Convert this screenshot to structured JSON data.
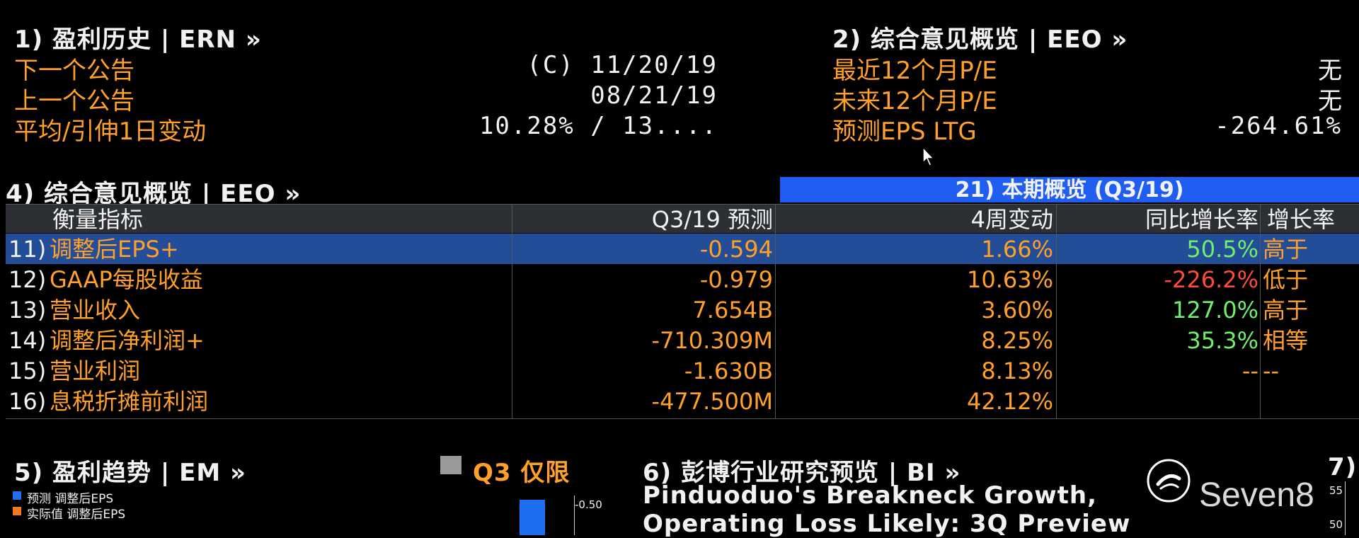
{
  "earnings_history": {
    "title": "1) 盈利历史  |  ERN »",
    "rows": [
      {
        "label": "下一个公告",
        "value": "(C)  11/20/19"
      },
      {
        "label": "上一个公告",
        "value": "08/21/19"
      },
      {
        "label": "平均/引伸1日变动",
        "value": "10.28% / 13...."
      }
    ]
  },
  "consensus_top": {
    "title": "2) 综合意见概览  |  EEO »",
    "rows": [
      {
        "label": "最近12个月P/E",
        "value": "无"
      },
      {
        "label": "未来12个月P/E",
        "value": "无"
      },
      {
        "label": "预测EPS LTG",
        "value": "-264.61%"
      }
    ]
  },
  "consensus_table": {
    "title": "4) 综合意见概览  |  EEO »",
    "banner": "21) 本期概览 (Q3/19)",
    "headers": [
      "衡量指标",
      "Q3/19 预测",
      "4周变动",
      "同比增长率",
      "增长率"
    ],
    "rows": [
      {
        "num": "11)",
        "metric": "调整后EPS+",
        "forecast": "-0.594",
        "change": "1.66%",
        "yoy": "50.5%",
        "yoy_color": "green",
        "growth": "高于"
      },
      {
        "num": "12)",
        "metric": "GAAP每股收益",
        "forecast": "-0.979",
        "change": "10.63%",
        "yoy": "-226.2%",
        "yoy_color": "red",
        "growth": "低于"
      },
      {
        "num": "13)",
        "metric": "营业收入",
        "forecast": "7.654B",
        "change": "3.60%",
        "yoy": "127.0%",
        "yoy_color": "green",
        "growth": "高于"
      },
      {
        "num": "14)",
        "metric": "调整后净利润+",
        "forecast": "-710.309M",
        "change": "8.25%",
        "yoy": "35.3%",
        "yoy_color": "green",
        "growth": "相等"
      },
      {
        "num": "15)",
        "metric": "营业利润",
        "forecast": "-1.630B",
        "change": "8.13%",
        "yoy": "--",
        "yoy_color": "orange",
        "growth": "--"
      },
      {
        "num": "16)",
        "metric": "息税折摊前利润",
        "forecast": "-477.500M",
        "change": "42.12%",
        "yoy": "",
        "yoy_color": "orange",
        "growth": ""
      }
    ]
  },
  "earnings_trend": {
    "title": "5) 盈利趋势  |  EM »",
    "toggle_label": "Q3 仅限",
    "legend": [
      {
        "label": "预测 调整后EPS",
        "color": "#1e6ff0"
      },
      {
        "label": "实际值 调整后EPS",
        "color": "#f07a20"
      }
    ],
    "axis_tick": "0.50"
  },
  "bi_research": {
    "title": "6) 彭博行业研究预览  |  BI »",
    "headline_line1": "Pinduoduo's Breakneck Growth,",
    "headline_line2": "Operating Loss Likely: 3Q Preview"
  },
  "panel7": {
    "title": "7)",
    "ticks": [
      "55",
      "50"
    ]
  },
  "watermark": "Seven8",
  "colors": {
    "background": "#000000",
    "orange": "#ffa028",
    "green": "#6ff06a",
    "red": "#ff4a3a",
    "selected_row": "#244d97",
    "banner": "#1f5ef0"
  }
}
